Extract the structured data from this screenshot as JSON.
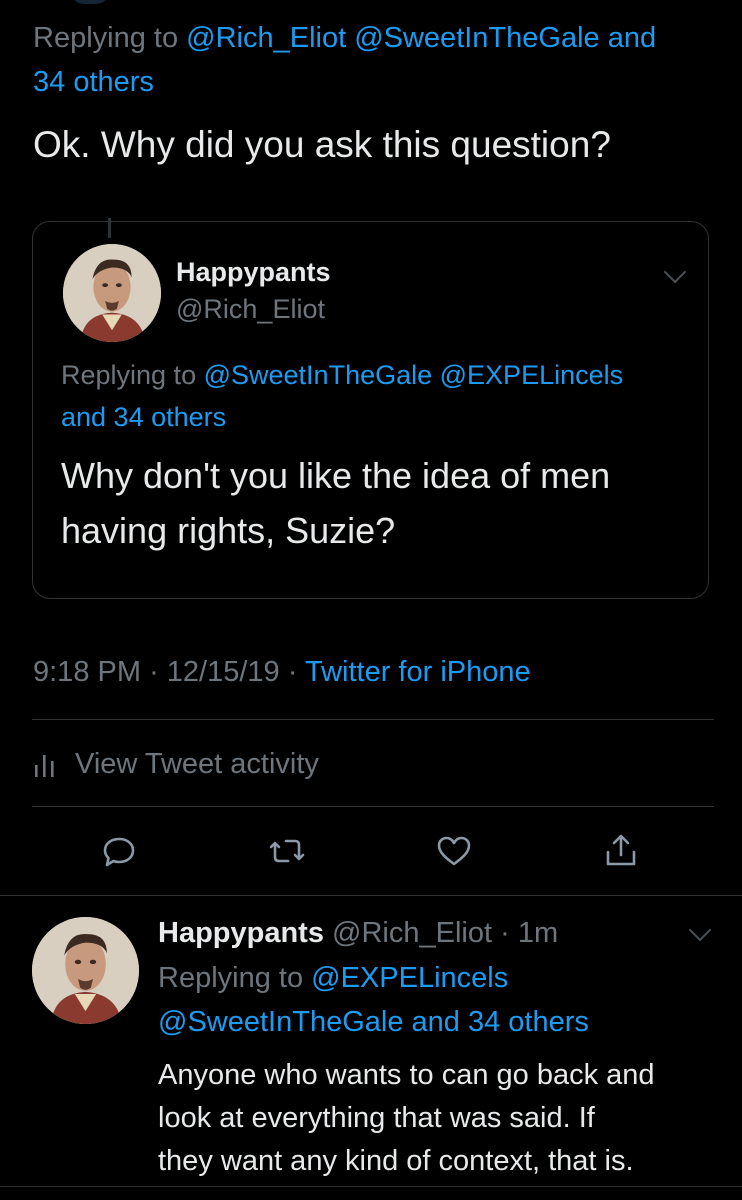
{
  "main_tweet": {
    "replying_prefix": "Replying to",
    "replying_to_1": "@Rich_Eliot @SweetInTheGale and",
    "replying_to_2": "34 others",
    "text": "Ok. Why did you ask this question?",
    "time": "9:18 PM",
    "dot1": "·",
    "date": "12/15/19",
    "dot2": "·",
    "source": "Twitter for iPhone"
  },
  "quote": {
    "display_name": "Happypants",
    "handle": "@Rich_Eliot",
    "replying_prefix": "Replying to",
    "replying_to_1": "@SweetInTheGale @EXPELincels",
    "replying_to_2": "and 34 others",
    "text_line1": "Why don't you like the idea of men",
    "text_line2": "having rights, Suzie?"
  },
  "activity": {
    "label": "View Tweet activity",
    "icon": "bar-chart-icon"
  },
  "actions": {
    "icons": [
      "reply-icon",
      "retweet-icon",
      "like-icon",
      "share-icon"
    ]
  },
  "reply_tweet": {
    "display_name": "Happypants",
    "handle": "@Rich_Eliot",
    "dot": "·",
    "age": "1m",
    "replying_prefix": "Replying to",
    "replying_to_1": "@EXPELincels",
    "replying_to_2": "@SweetInTheGale and 34 others",
    "text_line1": "Anyone who wants to can go back and",
    "text_line2": "look at everything that was said. If",
    "text_line3": "they want any kind of context, that is."
  },
  "colors": {
    "background": "#000000",
    "link": "#1d9bf0",
    "muted": "#6e767d",
    "text": "#e7e9ea",
    "divider": "#2f3336"
  }
}
